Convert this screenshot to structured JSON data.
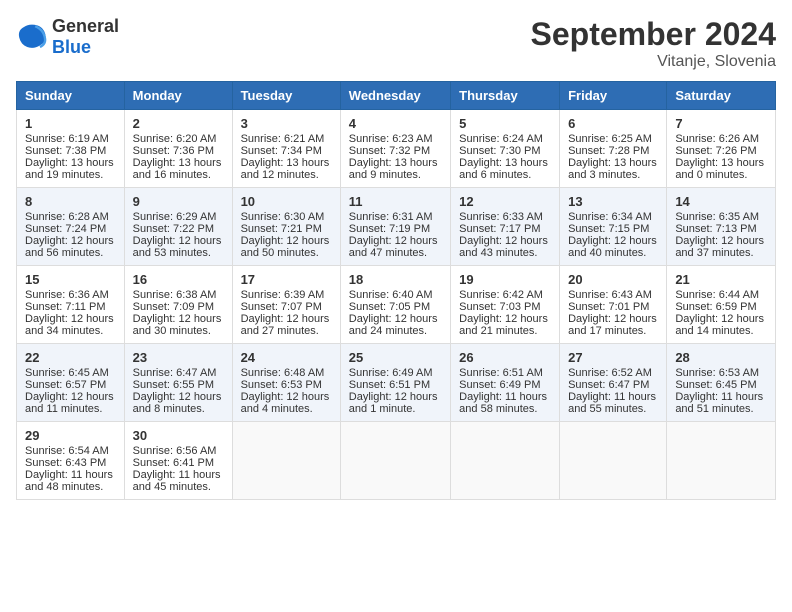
{
  "logo": {
    "general": "General",
    "blue": "Blue"
  },
  "header": {
    "month": "September 2024",
    "location": "Vitanje, Slovenia"
  },
  "weekdays": [
    "Sunday",
    "Monday",
    "Tuesday",
    "Wednesday",
    "Thursday",
    "Friday",
    "Saturday"
  ],
  "weeks": [
    [
      {
        "day": "1",
        "lines": [
          "Sunrise: 6:19 AM",
          "Sunset: 7:38 PM",
          "Daylight: 13 hours",
          "and 19 minutes."
        ]
      },
      {
        "day": "2",
        "lines": [
          "Sunrise: 6:20 AM",
          "Sunset: 7:36 PM",
          "Daylight: 13 hours",
          "and 16 minutes."
        ]
      },
      {
        "day": "3",
        "lines": [
          "Sunrise: 6:21 AM",
          "Sunset: 7:34 PM",
          "Daylight: 13 hours",
          "and 12 minutes."
        ]
      },
      {
        "day": "4",
        "lines": [
          "Sunrise: 6:23 AM",
          "Sunset: 7:32 PM",
          "Daylight: 13 hours",
          "and 9 minutes."
        ]
      },
      {
        "day": "5",
        "lines": [
          "Sunrise: 6:24 AM",
          "Sunset: 7:30 PM",
          "Daylight: 13 hours",
          "and 6 minutes."
        ]
      },
      {
        "day": "6",
        "lines": [
          "Sunrise: 6:25 AM",
          "Sunset: 7:28 PM",
          "Daylight: 13 hours",
          "and 3 minutes."
        ]
      },
      {
        "day": "7",
        "lines": [
          "Sunrise: 6:26 AM",
          "Sunset: 7:26 PM",
          "Daylight: 13 hours",
          "and 0 minutes."
        ]
      }
    ],
    [
      {
        "day": "8",
        "lines": [
          "Sunrise: 6:28 AM",
          "Sunset: 7:24 PM",
          "Daylight: 12 hours",
          "and 56 minutes."
        ]
      },
      {
        "day": "9",
        "lines": [
          "Sunrise: 6:29 AM",
          "Sunset: 7:22 PM",
          "Daylight: 12 hours",
          "and 53 minutes."
        ]
      },
      {
        "day": "10",
        "lines": [
          "Sunrise: 6:30 AM",
          "Sunset: 7:21 PM",
          "Daylight: 12 hours",
          "and 50 minutes."
        ]
      },
      {
        "day": "11",
        "lines": [
          "Sunrise: 6:31 AM",
          "Sunset: 7:19 PM",
          "Daylight: 12 hours",
          "and 47 minutes."
        ]
      },
      {
        "day": "12",
        "lines": [
          "Sunrise: 6:33 AM",
          "Sunset: 7:17 PM",
          "Daylight: 12 hours",
          "and 43 minutes."
        ]
      },
      {
        "day": "13",
        "lines": [
          "Sunrise: 6:34 AM",
          "Sunset: 7:15 PM",
          "Daylight: 12 hours",
          "and 40 minutes."
        ]
      },
      {
        "day": "14",
        "lines": [
          "Sunrise: 6:35 AM",
          "Sunset: 7:13 PM",
          "Daylight: 12 hours",
          "and 37 minutes."
        ]
      }
    ],
    [
      {
        "day": "15",
        "lines": [
          "Sunrise: 6:36 AM",
          "Sunset: 7:11 PM",
          "Daylight: 12 hours",
          "and 34 minutes."
        ]
      },
      {
        "day": "16",
        "lines": [
          "Sunrise: 6:38 AM",
          "Sunset: 7:09 PM",
          "Daylight: 12 hours",
          "and 30 minutes."
        ]
      },
      {
        "day": "17",
        "lines": [
          "Sunrise: 6:39 AM",
          "Sunset: 7:07 PM",
          "Daylight: 12 hours",
          "and 27 minutes."
        ]
      },
      {
        "day": "18",
        "lines": [
          "Sunrise: 6:40 AM",
          "Sunset: 7:05 PM",
          "Daylight: 12 hours",
          "and 24 minutes."
        ]
      },
      {
        "day": "19",
        "lines": [
          "Sunrise: 6:42 AM",
          "Sunset: 7:03 PM",
          "Daylight: 12 hours",
          "and 21 minutes."
        ]
      },
      {
        "day": "20",
        "lines": [
          "Sunrise: 6:43 AM",
          "Sunset: 7:01 PM",
          "Daylight: 12 hours",
          "and 17 minutes."
        ]
      },
      {
        "day": "21",
        "lines": [
          "Sunrise: 6:44 AM",
          "Sunset: 6:59 PM",
          "Daylight: 12 hours",
          "and 14 minutes."
        ]
      }
    ],
    [
      {
        "day": "22",
        "lines": [
          "Sunrise: 6:45 AM",
          "Sunset: 6:57 PM",
          "Daylight: 12 hours",
          "and 11 minutes."
        ]
      },
      {
        "day": "23",
        "lines": [
          "Sunrise: 6:47 AM",
          "Sunset: 6:55 PM",
          "Daylight: 12 hours",
          "and 8 minutes."
        ]
      },
      {
        "day": "24",
        "lines": [
          "Sunrise: 6:48 AM",
          "Sunset: 6:53 PM",
          "Daylight: 12 hours",
          "and 4 minutes."
        ]
      },
      {
        "day": "25",
        "lines": [
          "Sunrise: 6:49 AM",
          "Sunset: 6:51 PM",
          "Daylight: 12 hours",
          "and 1 minute."
        ]
      },
      {
        "day": "26",
        "lines": [
          "Sunrise: 6:51 AM",
          "Sunset: 6:49 PM",
          "Daylight: 11 hours",
          "and 58 minutes."
        ]
      },
      {
        "day": "27",
        "lines": [
          "Sunrise: 6:52 AM",
          "Sunset: 6:47 PM",
          "Daylight: 11 hours",
          "and 55 minutes."
        ]
      },
      {
        "day": "28",
        "lines": [
          "Sunrise: 6:53 AM",
          "Sunset: 6:45 PM",
          "Daylight: 11 hours",
          "and 51 minutes."
        ]
      }
    ],
    [
      {
        "day": "29",
        "lines": [
          "Sunrise: 6:54 AM",
          "Sunset: 6:43 PM",
          "Daylight: 11 hours",
          "and 48 minutes."
        ]
      },
      {
        "day": "30",
        "lines": [
          "Sunrise: 6:56 AM",
          "Sunset: 6:41 PM",
          "Daylight: 11 hours",
          "and 45 minutes."
        ]
      },
      null,
      null,
      null,
      null,
      null
    ]
  ]
}
